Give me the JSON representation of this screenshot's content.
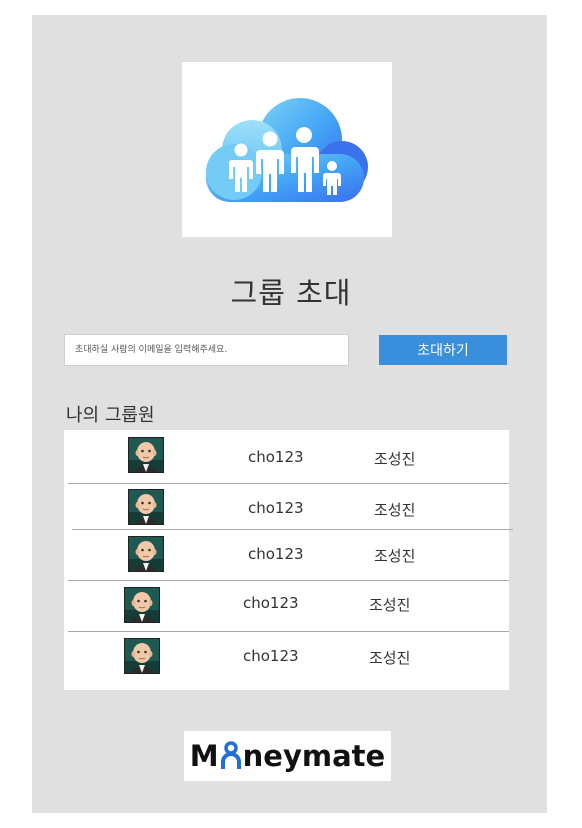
{
  "title": "그룹 초대",
  "invite": {
    "placeholder": "초대하실 사람의 이메일을 입력해주세요.",
    "button_label": "초대하기"
  },
  "members": {
    "heading": "나의 그룹원",
    "rows": [
      {
        "id": "cho123",
        "name": "조성진"
      },
      {
        "id": "cho123",
        "name": "조성진"
      },
      {
        "id": "cho123",
        "name": "조성진"
      },
      {
        "id": "cho123",
        "name": "조성진"
      },
      {
        "id": "cho123",
        "name": "조성진"
      }
    ]
  },
  "logo": {
    "part1": "M",
    "part2": "neymate"
  },
  "colors": {
    "panel": "#e0e0e0",
    "accent": "#3a8fdc",
    "logo_blue": "#1f6fd6"
  },
  "icons": {
    "hero": "family-sharing-cloud-icon",
    "avatar": "boss-baby-avatar-icon"
  }
}
